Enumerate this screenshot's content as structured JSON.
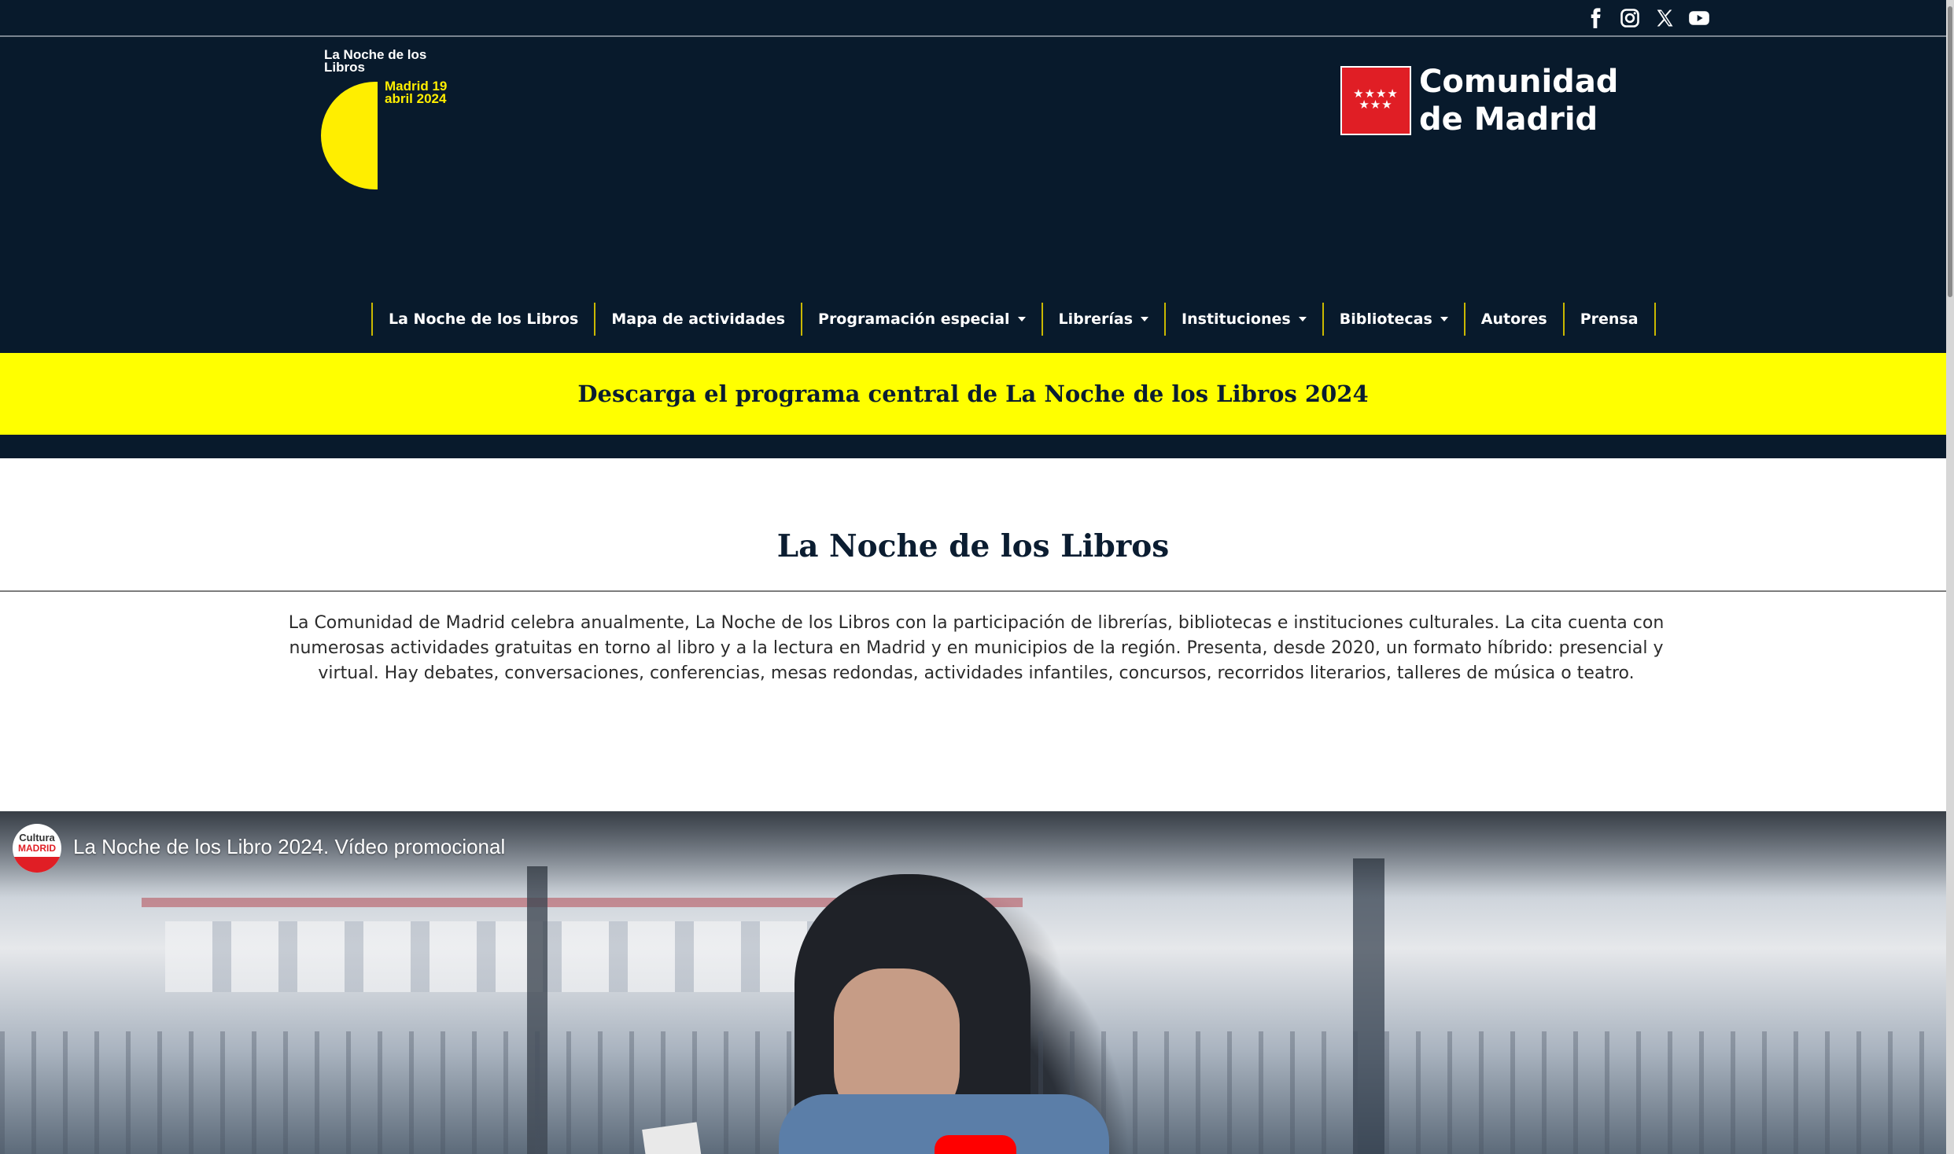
{
  "social": {
    "icons": [
      "facebook-icon",
      "instagram-icon",
      "x-icon",
      "youtube-icon"
    ],
    "labels": [
      "Facebook",
      "Instagram",
      "X",
      "YouTube"
    ]
  },
  "event_logo": {
    "title": "La Noche de los Libros",
    "date": "Madrid 19 abril 2024"
  },
  "cm_logo": {
    "line1": "Comunidad",
    "line2": "de Madrid",
    "stars": "★★★★\n★★★"
  },
  "nav": {
    "items": [
      {
        "label": "La Noche de los Libros",
        "dropdown": false
      },
      {
        "label": "Mapa de actividades",
        "dropdown": false
      },
      {
        "label": "Programación especial",
        "dropdown": true
      },
      {
        "label": "Librerías",
        "dropdown": true
      },
      {
        "label": "Instituciones",
        "dropdown": true
      },
      {
        "label": "Bibliotecas",
        "dropdown": true
      },
      {
        "label": "Autores",
        "dropdown": false
      },
      {
        "label": "Prensa",
        "dropdown": false
      }
    ]
  },
  "banner": {
    "text": "Descarga el programa central de La Noche de los Libros 2024"
  },
  "main": {
    "title": "La Noche de los Libros",
    "intro": "La Comunidad de Madrid celebra anualmente, La Noche de los Libros con la participación de librerías, bibliotecas e instituciones culturales. La cita cuenta con numerosas actividades gratuitas en torno al libro y a la lectura en Madrid y en municipios de la región. Presenta, desde 2020, un formato híbrido: presencial y virtual. Hay debates, conversaciones, conferencias, mesas redondas, actividades infantiles, concursos, recorridos literarios, talleres de música o teatro."
  },
  "video": {
    "title": "La Noche de los Libro 2024. Vídeo promocional",
    "channel_top": "Cultura",
    "channel_mid": "MADRID"
  },
  "colors": {
    "header_bg": "#081a2c",
    "accent_yellow": "#ffff00",
    "logo_yellow": "#ffee00",
    "madrid_red": "#e01e25"
  }
}
